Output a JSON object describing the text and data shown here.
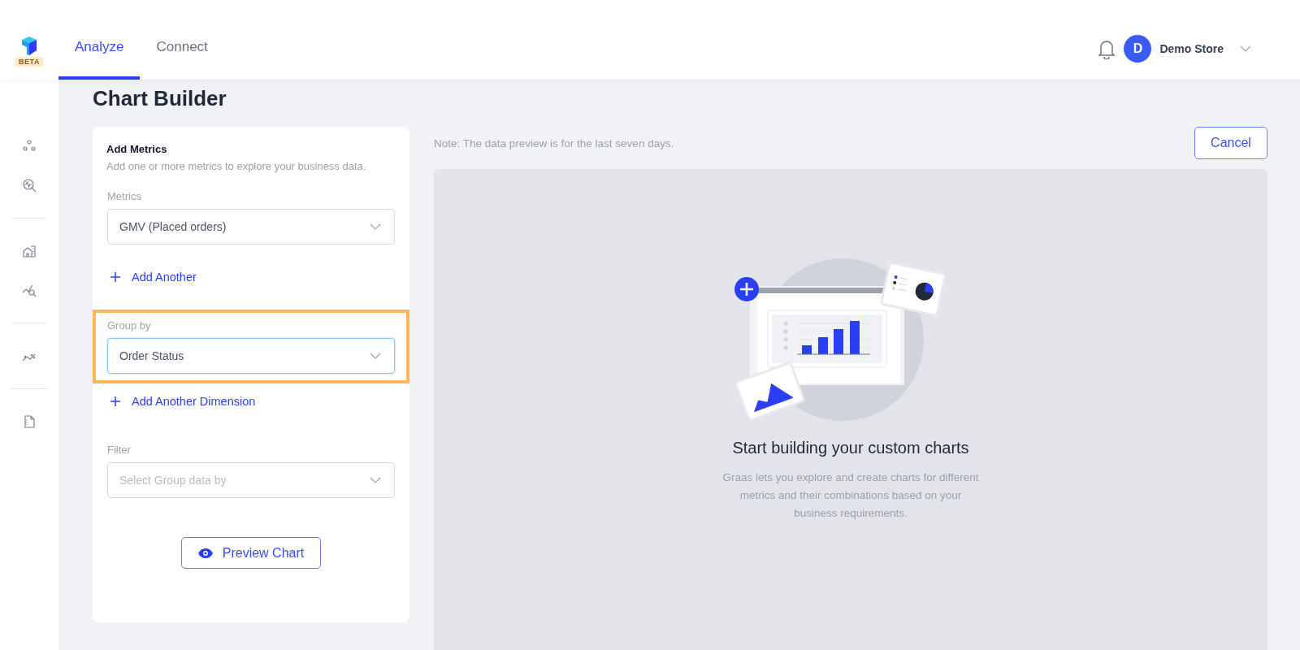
{
  "header": {
    "logo_badge": "BETA",
    "tabs": [
      {
        "label": "Analyze",
        "selected": true
      },
      {
        "label": "Connect",
        "selected": false
      }
    ],
    "user": {
      "initial": "D",
      "name": "Demo Store"
    }
  },
  "page": {
    "title": "Chart Builder"
  },
  "form": {
    "title": "Add Metrics",
    "subtitle": "Add one or more metrics to explore your business data.",
    "sections": [
      {
        "label": "Metrics",
        "value": "GMV (Placed orders)",
        "highlighted": false,
        "focused": false,
        "add_link": "Add Another"
      },
      {
        "label": "Group by",
        "value": "Order Status",
        "highlighted": true,
        "focused": true,
        "add_link": "Add Another Dimension"
      },
      {
        "label": "Filter",
        "placeholder": "Select Group data by",
        "highlighted": false,
        "focused": false
      }
    ],
    "preview_button": "Preview Chart"
  },
  "preview": {
    "note": "Note: The data preview is for the last seven days.",
    "cancel_button": "Cancel",
    "empty_title": "Start building your custom charts",
    "empty_text": "Graas lets you explore and create charts for different metrics and their combinations based on your business requirements."
  }
}
